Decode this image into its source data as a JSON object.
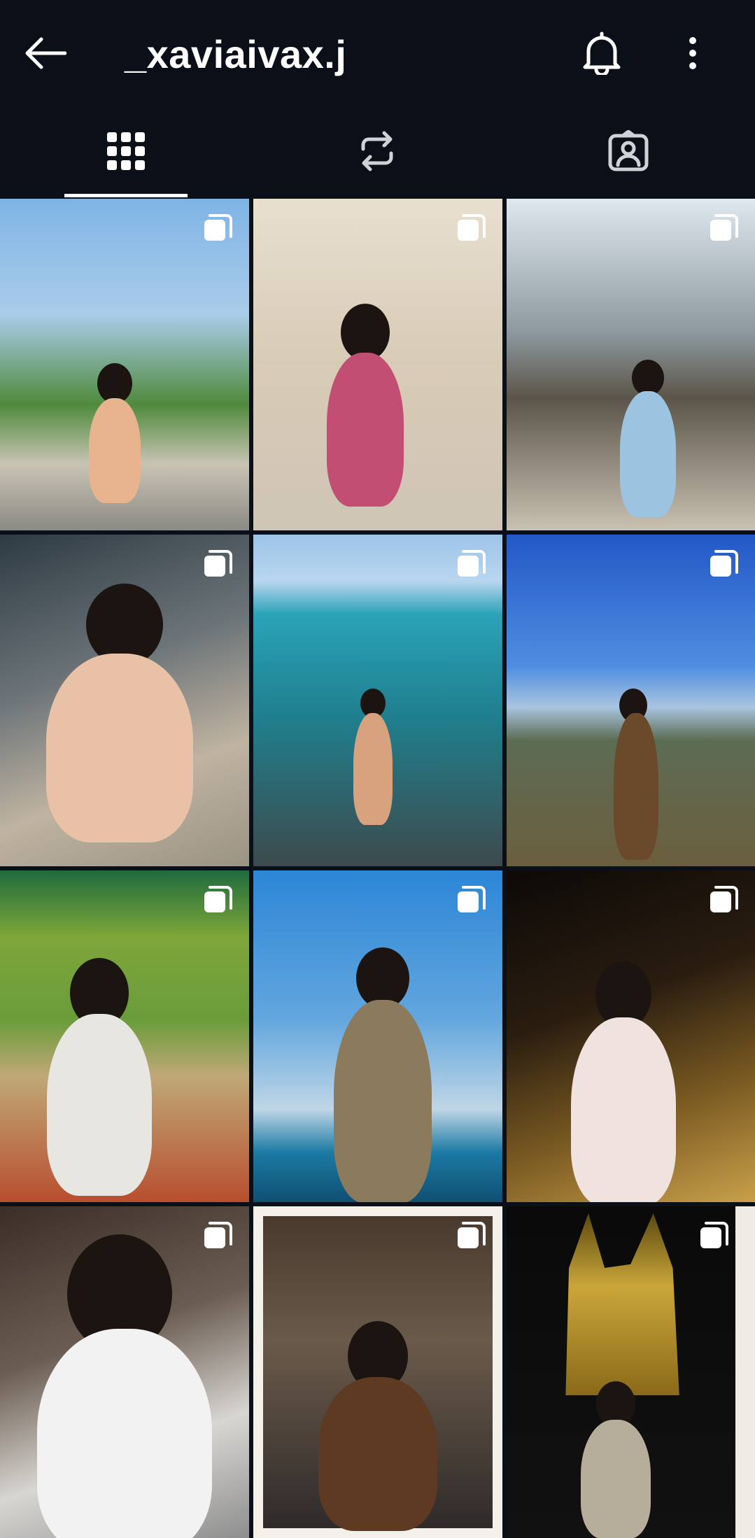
{
  "header": {
    "username": "_xaviaivax.j",
    "back_icon": "arrow-left-icon",
    "notification_icon": "bell-icon",
    "menu_icon": "more-vertical-icon"
  },
  "tabs": [
    {
      "icon": "grid-icon",
      "selected": true
    },
    {
      "icon": "repost-icon",
      "selected": false
    },
    {
      "icon": "tagged-user-icon",
      "selected": false
    }
  ],
  "posts": [
    {
      "badge": "carousel-icon"
    },
    {
      "badge": "carousel-icon"
    },
    {
      "badge": "carousel-icon"
    },
    {
      "badge": "carousel-icon"
    },
    {
      "badge": "carousel-icon"
    },
    {
      "badge": "carousel-icon"
    },
    {
      "badge": "carousel-icon"
    },
    {
      "badge": "carousel-icon"
    },
    {
      "badge": "carousel-icon"
    },
    {
      "badge": "carousel-icon"
    },
    {
      "badge": "carousel-icon"
    },
    {
      "badge": "carousel-icon"
    }
  ],
  "colors": {
    "background": "#0b0f17",
    "foreground": "#ffffff"
  }
}
